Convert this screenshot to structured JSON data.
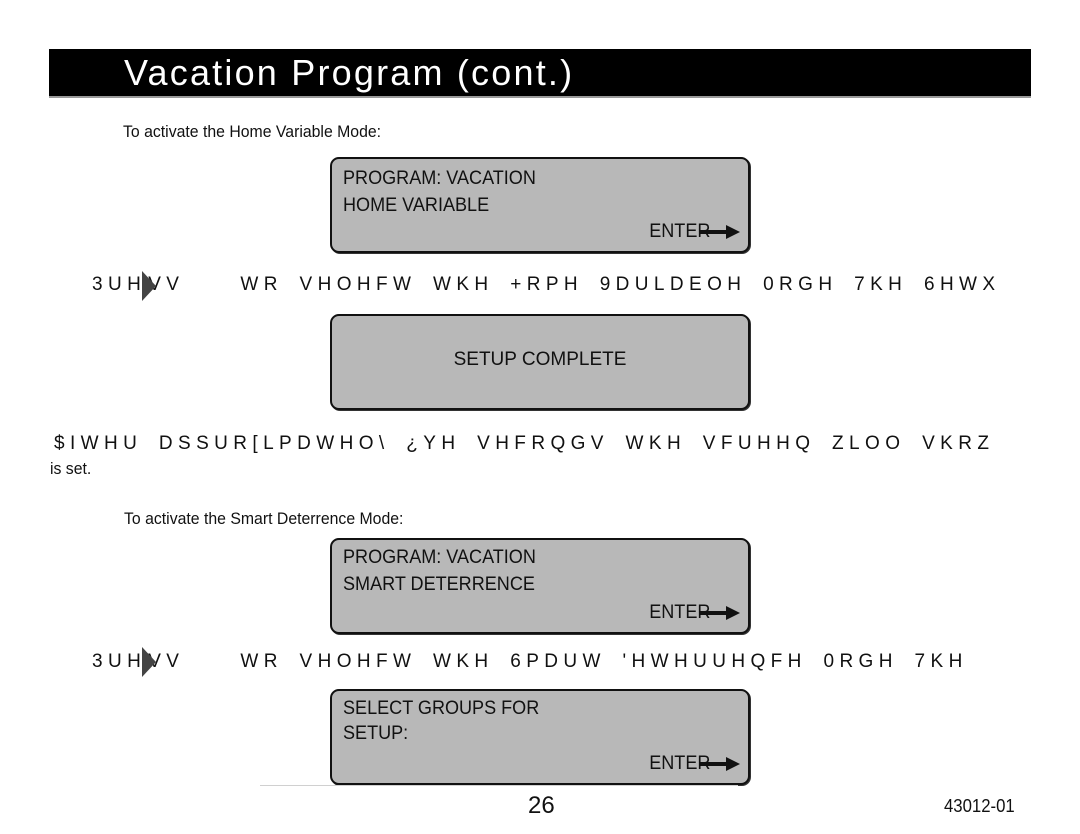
{
  "page": {
    "title": "Vacation Program (cont.)",
    "page_number": "26",
    "doc_number": "43012-01"
  },
  "colors": {
    "title_bg": "#000000",
    "title_text": "#ffffff",
    "lcd_bg": "#b8b8b8",
    "lcd_border": "#111111"
  },
  "sections": {
    "home_variable": {
      "intro": "To activate the Home Variable Mode:",
      "lcd": {
        "line1": "PROGRAM: VACATION",
        "line2": "HOME VARIABLE",
        "enter_label": "ENTER",
        "enter_icon": "right-arrow-icon"
      },
      "press_prefix": "3UH",
      "press_suffix": "VV",
      "press_icon": "right-triangle-icon",
      "instruction_garbled": "WR VHOHFW WKH +RPH 9DULDEOH 0RGH  7KH 6HWX",
      "lcd_result": {
        "line1": "SETUP COMPLETE"
      },
      "after_garbled": "$IWHU DSSUR[LPDWHO\\ ¿YH VHFRQGV WKH VFUHHQ ZLOO VKRZ",
      "after_continued": "is set."
    },
    "smart_deterrence": {
      "intro": "To activate the Smart Deterrence Mode:",
      "lcd": {
        "line1": "PROGRAM: VACATION",
        "line2": "SMART DETERRENCE",
        "enter_label": "ENTER",
        "enter_icon": "right-arrow-icon"
      },
      "press_prefix": "3UH",
      "press_suffix": "VV",
      "press_icon": "right-triangle-icon",
      "instruction_garbled": "WR VHOHFW WKH 6PDUW 'HWHUUHQFH 0RGH  7KH",
      "lcd_result": {
        "line1": "SELECT GROUPS FOR",
        "line2": "SETUP:",
        "enter_label": "ENTER",
        "enter_icon": "right-arrow-icon"
      }
    }
  }
}
